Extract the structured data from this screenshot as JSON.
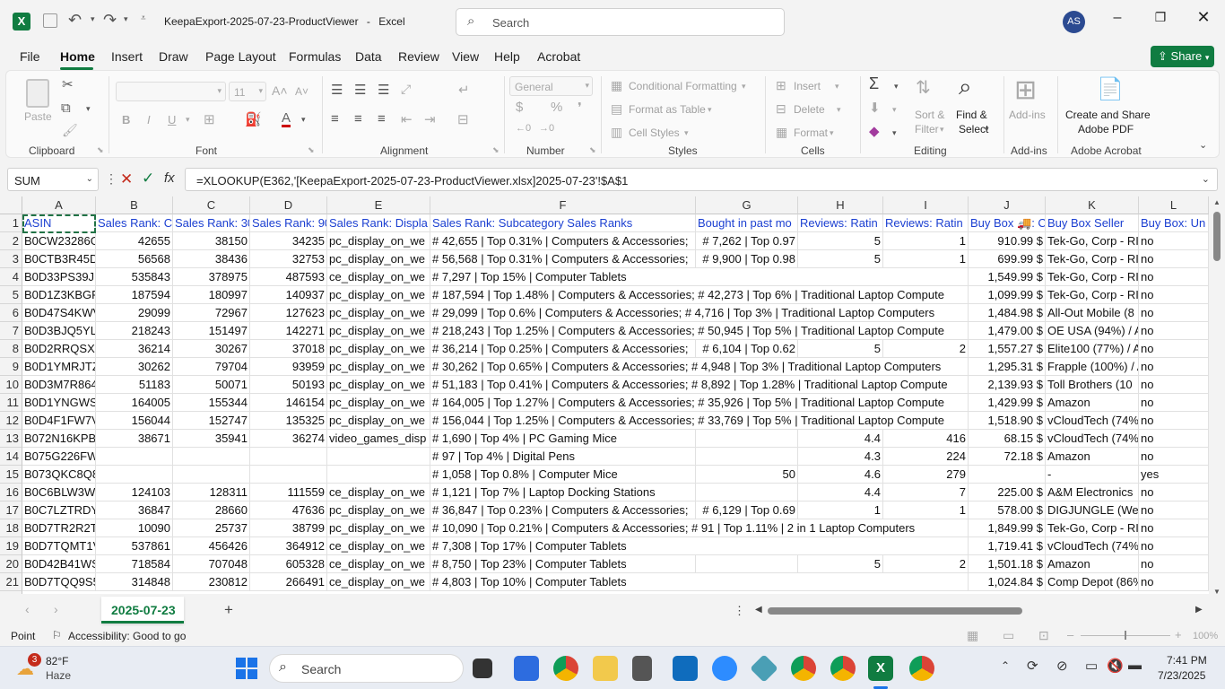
{
  "titlebar": {
    "filename": "KeepaExport-2025-07-23-ProductViewer",
    "separator": "-",
    "app": "Excel",
    "search_placeholder": "Search",
    "avatar": "AS"
  },
  "menu": [
    "File",
    "Home",
    "Insert",
    "Draw",
    "Page Layout",
    "Formulas",
    "Data",
    "Review",
    "View",
    "Help",
    "Acrobat"
  ],
  "share": "Share",
  "ribbon": {
    "groups": [
      "Clipboard",
      "Font",
      "Alignment",
      "Number",
      "Styles",
      "Cells",
      "Editing",
      "Add-ins",
      "Adobe Acrobat"
    ],
    "paste": "Paste",
    "font_size": "11",
    "number_format": "General",
    "conditional_formatting": "Conditional Formatting",
    "format_as_table": "Format as Table",
    "cell_styles": "Cell Styles",
    "insert": "Insert",
    "delete": "Delete",
    "format": "Format",
    "sort_filter_1": "Sort &",
    "sort_filter_2": "Filter",
    "find_select_1": "Find &",
    "find_select_2": "Select",
    "addins": "Add-ins",
    "acrobat_1": "Create and Share",
    "acrobat_2": "Adobe PDF"
  },
  "formula_bar": {
    "name_box": "SUM",
    "formula": "=XLOOKUP(E362,'[KeepaExport-2025-07-23-ProductViewer.xlsx]2025-07-23'!$A$1"
  },
  "grid": {
    "columns": [
      "A",
      "B",
      "C",
      "D",
      "E",
      "F",
      "G",
      "H",
      "I",
      "J",
      "K",
      "L"
    ],
    "header_row": [
      "ASIN",
      "Sales Rank: Cu",
      "Sales Rank: 30",
      "Sales Rank: 90",
      "Sales Rank: Displa",
      "Sales Rank: Subcategory Sales Ranks",
      "Bought in past mo",
      "Reviews: Ratin",
      "Reviews: Ratin",
      "Buy Box 🚚: C",
      "Buy Box Seller",
      "Buy Box: Un"
    ],
    "rows": [
      [
        "B0CW23286G",
        "42655",
        "38150",
        "34235",
        "pc_display_on_we",
        "# 42,655 | Top 0.31% | Computers & Accessories;",
        "# 7,262 | Top 0.97",
        "5",
        "1",
        "910.99 $",
        "Tek-Go, Corp - RI",
        "no"
      ],
      [
        "B0CTB3R45D",
        "56568",
        "38436",
        "32753",
        "pc_display_on_we",
        "# 56,568 | Top 0.31% | Computers & Accessories;",
        "# 9,900 | Top 0.98",
        "5",
        "1",
        "699.99 $",
        "Tek-Go, Corp - RI",
        "no"
      ],
      [
        "B0D33PS39J",
        "535843",
        "378975",
        "487593",
        "ce_display_on_we",
        "# 7,297 | Top 15% | Computer Tablets",
        "",
        "",
        "",
        "1,549.99 $",
        "Tek-Go, Corp - RI",
        "no"
      ],
      [
        "B0D1Z3KBGP",
        "187594",
        "180997",
        "140937",
        "pc_display_on_we",
        "# 187,594 | Top 1.48% | Computers & Accessories; # 42,273 | Top 6% | Traditional Laptop Compute",
        "",
        "",
        "",
        "1,099.99 $",
        "Tek-Go, Corp - RI",
        "no"
      ],
      [
        "B0D47S4KWV",
        "29099",
        "72967",
        "127623",
        "pc_display_on_we",
        "# 29,099 | Top 0.6% | Computers & Accessories; # 4,716 | Top 3% | Traditional Laptop Computers",
        "",
        "",
        "",
        "1,484.98 $",
        "All-Out Mobile (8",
        "no"
      ],
      [
        "B0D3BJQ5YL",
        "218243",
        "151497",
        "142271",
        "pc_display_on_we",
        "# 218,243 | Top 1.25% | Computers & Accessories; # 50,945 | Top 5% | Traditional Laptop Compute",
        "",
        "",
        "",
        "1,479.00 $",
        "OE USA (94%) / A",
        "no"
      ],
      [
        "B0D2RRQSXH",
        "36214",
        "30267",
        "37018",
        "pc_display_on_we",
        "# 36,214 | Top 0.25% | Computers & Accessories;",
        "# 6,104 | Top 0.62",
        "5",
        "2",
        "1,557.27 $",
        "Elite100 (77%) / A",
        "no"
      ],
      [
        "B0D1YMRJTZ",
        "30262",
        "79704",
        "93959",
        "pc_display_on_we",
        "# 30,262 | Top 0.65% | Computers & Accessories; # 4,948 | Top 3% | Traditional Laptop Computers",
        "",
        "",
        "",
        "1,295.31 $",
        "Frapple (100%) / A",
        "no"
      ],
      [
        "B0D3M7R864",
        "51183",
        "50071",
        "50193",
        "pc_display_on_we",
        "# 51,183 | Top 0.41% | Computers & Accessories; # 8,892 | Top 1.28% | Traditional Laptop Compute",
        "",
        "",
        "",
        "2,139.93 $",
        "Toll Brothers (10",
        "no"
      ],
      [
        "B0D1YNGWS",
        "164005",
        "155344",
        "146154",
        "pc_display_on_we",
        "# 164,005 | Top 1.27% | Computers & Accessories; # 35,926 | Top 5% | Traditional Laptop Compute",
        "",
        "",
        "",
        "1,429.99 $",
        "Amazon",
        "no"
      ],
      [
        "B0D4F1FW7V",
        "156044",
        "152747",
        "135325",
        "pc_display_on_we",
        "# 156,044 | Top 1.25% | Computers & Accessories; # 33,769 | Top 5% | Traditional Laptop Compute",
        "",
        "",
        "",
        "1,518.90 $",
        "vCloudTech (74%",
        "no"
      ],
      [
        "B072N16KPB",
        "38671",
        "35941",
        "36274",
        "video_games_disp",
        "# 1,690 | Top 4% | PC Gaming Mice",
        "",
        "4.4",
        "416",
        "68.15 $",
        "vCloudTech (74%",
        "no"
      ],
      [
        "B075G226FW",
        "",
        "",
        "",
        "",
        "# 97 | Top 4% | Digital Pens",
        "",
        "4.3",
        "224",
        "72.18 $",
        "Amazon",
        "no"
      ],
      [
        "B073QKC8Q8",
        "",
        "",
        "",
        "",
        "# 1,058 | Top 0.8% | Computer Mice",
        "50",
        "4.6",
        "279",
        "",
        "-",
        "yes"
      ],
      [
        "B0C6BLW3W",
        "124103",
        "128311",
        "111559",
        "ce_display_on_we",
        "# 1,121 | Top 7% | Laptop Docking Stations",
        "",
        "4.4",
        "7",
        "225.00 $",
        "A&M Electronics",
        "no"
      ],
      [
        "B0C7LZTRDY",
        "36847",
        "28660",
        "47636",
        "pc_display_on_we",
        "# 36,847 | Top 0.23% | Computers & Accessories;",
        "# 6,129 | Top 0.69",
        "1",
        "1",
        "578.00 $",
        "DIGJUNGLE (We L",
        "no"
      ],
      [
        "B0D7TR2R2T",
        "10090",
        "25737",
        "38799",
        "pc_display_on_we",
        "# 10,090 | Top 0.21% | Computers & Accessories; # 91 | Top 1.11% | 2 in 1 Laptop Computers",
        "",
        "",
        "",
        "1,849.99 $",
        "Tek-Go, Corp - RI",
        "no"
      ],
      [
        "B0D7TQMT1V",
        "537861",
        "456426",
        "364912",
        "ce_display_on_we",
        "# 7,308 | Top 17% | Computer Tablets",
        "",
        "",
        "",
        "1,719.41 $",
        "vCloudTech (74%",
        "no"
      ],
      [
        "B0D42B41WS",
        "718584",
        "707048",
        "605328",
        "ce_display_on_we",
        "# 8,750 | Top 23% | Computer Tablets",
        "",
        "5",
        "2",
        "1,501.18 $",
        "Amazon",
        "no"
      ],
      [
        "B0D7TQQ9S5",
        "314848",
        "230812",
        "266491",
        "ce_display_on_we",
        "# 4,803 | Top 10% | Computer Tablets",
        "",
        "",
        "",
        "1,024.84 $",
        "Comp Depot (86%",
        "no"
      ]
    ]
  },
  "sheet_tab": "2025-07-23",
  "status": {
    "mode": "Point",
    "accessibility": "Accessibility: Good to go",
    "zoom": "100%"
  },
  "taskbar": {
    "weather_temp": "82°F",
    "weather_desc": "Haze",
    "weather_badge": "3",
    "search": "Search",
    "time": "7:41 PM",
    "date": "7/23/2025"
  },
  "colors": {
    "excel_green": "#107c41",
    "header_blue": "#1b3fd1",
    "selection_green": "#217346"
  }
}
